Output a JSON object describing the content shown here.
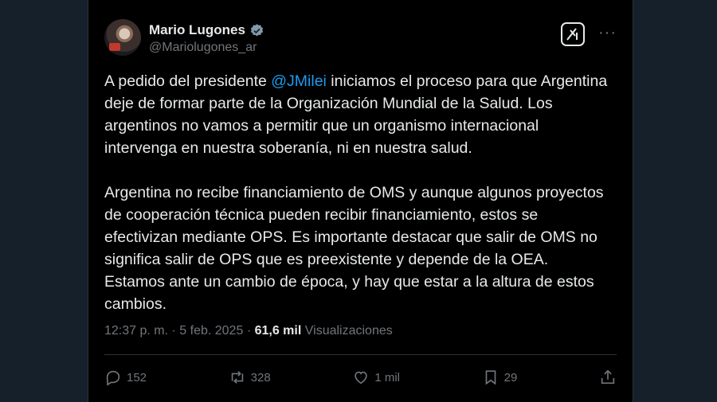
{
  "author": {
    "name": "Mario Lugones",
    "handle": "@Mariolugones_ar",
    "verified": true
  },
  "tweet": {
    "paragraph1_prefix": "A pedido del presidente ",
    "mention": "@JMilei",
    "paragraph1_suffix": " iniciamos el proceso para que Argentina\ndeje de formar parte de la Organización Mundial de la Salud. Los\nargentinos no vamos a permitir que un organismo internacional\nintervenga en nuestra soberanía, ni en nuestra salud.",
    "paragraph2": "Argentina no recibe financiamiento de OMS y aunque algunos proyectos\nde cooperación técnica pueden recibir financiamiento, estos se\nefectivizan mediante OPS. Es importante destacar que salir de OMS no\nsignifica salir de OPS que es preexistente y depende de la OEA.\nEstamos ante un cambio de época, y hay que estar a la altura de estos\ncambios."
  },
  "meta": {
    "time": "12:37 p. m.",
    "separator": "·",
    "date": "5 feb. 2025",
    "views_count": "61,6 mil",
    "views_label": "Visualizaciones"
  },
  "actions": {
    "replies": "152",
    "reposts": "328",
    "likes": "1 mil",
    "bookmarks": "29"
  },
  "icons": [
    "verified-badge-icon",
    "grok-icon",
    "more-icon",
    "reply-icon",
    "repost-icon",
    "like-icon",
    "bookmark-icon",
    "share-icon"
  ],
  "colors": {
    "background": "#15202b",
    "card": "#000000",
    "text": "#e7e9ea",
    "muted": "#71767b",
    "accent": "#1d9bf0"
  }
}
